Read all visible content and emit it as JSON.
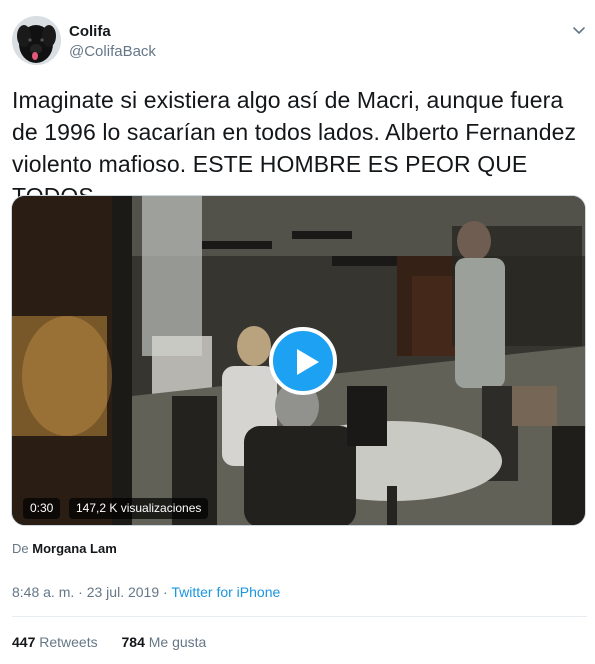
{
  "author": {
    "display_name": "Colifa",
    "handle": "@ColifaBack"
  },
  "tweet": {
    "text": "Imaginate si existiera algo así de Macri, aunque fuera de 1996 lo sacarían en todos lados. Alberto Fernandez violento mafioso. ESTE HOMBRE ES PEOR QUE TODOS."
  },
  "media": {
    "duration": "0:30",
    "views": "147,2 K visualizaciones",
    "play_icon": "play-icon"
  },
  "attribution": {
    "prefix": "De",
    "name": "Morgana Lam"
  },
  "meta": {
    "time": "8:48 a. m.",
    "separator1": " · ",
    "date": "23 jul. 2019",
    "separator2": " · ",
    "source": "Twitter for iPhone"
  },
  "stats": {
    "retweets_count": "447",
    "retweets_label": "Retweets",
    "likes_count": "784",
    "likes_label": "Me gusta"
  },
  "colors": {
    "accent": "#1da1f2",
    "link": "#1b95e0",
    "muted": "#657786",
    "text": "#14171a"
  }
}
